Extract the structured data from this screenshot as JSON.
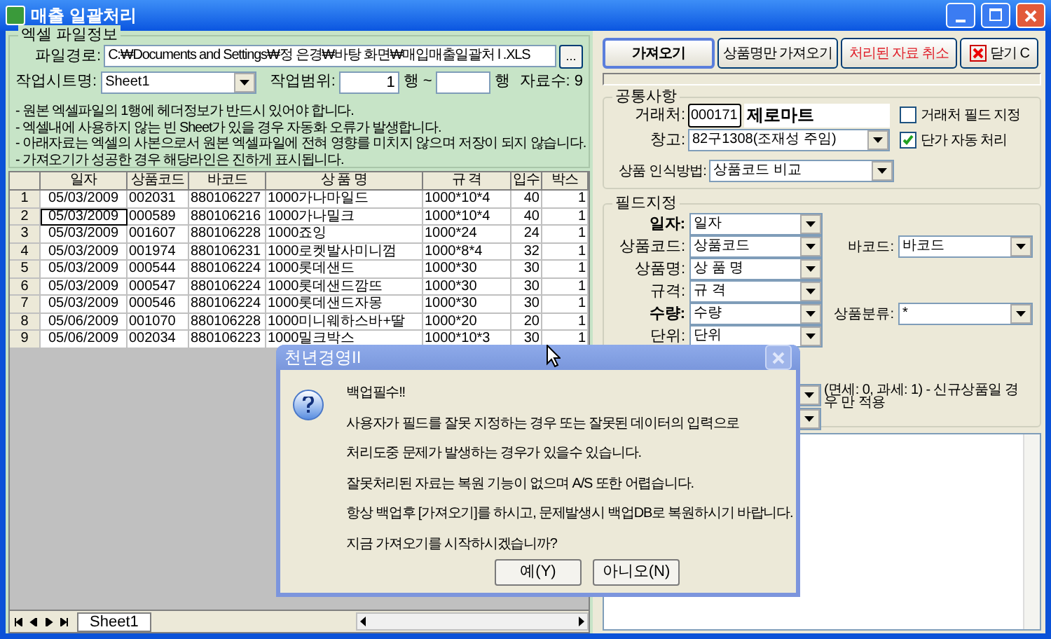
{
  "window": {
    "title": "매출 일괄처리"
  },
  "file_info": {
    "group_label": "엑셀 파일정보",
    "path_label": "파일경로:",
    "path_value": "C:₩Documents and Settings₩정 은경₩바탕 화면₩매입매출일괄처 l .XLS",
    "browse_label": "...",
    "sheet_label": "작업시트명:",
    "sheet_value": "Sheet1",
    "range_label": "작업범위:",
    "range_start": "1",
    "range_sep": "행 ~",
    "range_unit": "행",
    "count": "자료수:  9",
    "notes": [
      "- 원본 엑셀파일의 1행에 헤더정보가 반드시 있어야 합니다.",
      "- 엑셀내에 사용하지 않는 빈 Sheet가 있을 경우 자동화 오류가 발생합니다.",
      "- 아래자료는 엑셀의 사본으로서 원본 엑셀파일에 전혀 영향를 미치지 않으며 저장이 되지 않습니다.",
      "- 가져오기가 성공한 경우 해당라인은 진하게 표시됩니다."
    ]
  },
  "grid": {
    "columns": [
      {
        "kind": "num"
      },
      {
        "label": "일자",
        "kind": "center"
      },
      {
        "label": "상품코드",
        "kind": "text"
      },
      {
        "label": "바코드",
        "kind": "text"
      },
      {
        "label": "상 품 명",
        "kind": "text"
      },
      {
        "label": "규 격",
        "kind": "text"
      },
      {
        "label": "입수",
        "kind": "number"
      },
      {
        "label": "박스",
        "kind": "number"
      }
    ],
    "rows": [
      {
        "selected": false,
        "cells": [
          "1",
          "05/03/2009",
          "002031",
          "880106227",
          "1000가나마일드",
          "1000*10*4",
          "40",
          "1"
        ]
      },
      {
        "selected": true,
        "cells": [
          "2",
          "05/03/2009",
          "000589",
          "880106216",
          "1000가나밀크",
          "1000*10*4",
          "40",
          "1"
        ]
      },
      {
        "selected": false,
        "cells": [
          "3",
          "05/03/2009",
          "001607",
          "880106228",
          "1000죠잉",
          "1000*24",
          "24",
          "1"
        ]
      },
      {
        "selected": false,
        "cells": [
          "4",
          "05/03/2009",
          "001974",
          "880106231",
          "1000로켓발사미니껌",
          "1000*8*4",
          "32",
          "1"
        ]
      },
      {
        "selected": false,
        "cells": [
          "5",
          "05/03/2009",
          "000544",
          "880106224",
          "1000롯데샌드",
          "1000*30",
          "30",
          "1"
        ]
      },
      {
        "selected": false,
        "cells": [
          "6",
          "05/03/2009",
          "000547",
          "880106224",
          "1000롯데샌드깜뜨",
          "1000*30",
          "30",
          "1"
        ]
      },
      {
        "selected": false,
        "cells": [
          "7",
          "05/03/2009",
          "000546",
          "880106224",
          "1000롯데샌드자몽",
          "1000*30",
          "30",
          "1"
        ]
      },
      {
        "selected": false,
        "cells": [
          "8",
          "05/06/2009",
          "001070",
          "880106228",
          "1000미니웨하스바+딸",
          "1000*20",
          "20",
          "1"
        ]
      },
      {
        "selected": false,
        "cells": [
          "9",
          "05/06/2009",
          "002034",
          "880106223",
          "1000밀크박스",
          "1000*10*3",
          "30",
          "1"
        ]
      }
    ],
    "sheet_tabs": [
      {
        "label": "Sheet1",
        "selected": true
      }
    ]
  },
  "buttons": [
    {
      "label": "가져오기",
      "kind": "primary"
    },
    {
      "label": "상품명만 가져오기",
      "kind": "normal"
    },
    {
      "label": "처리된 자료 취소",
      "kind": "danger"
    },
    {
      "label": "닫기 C",
      "kind": "close"
    }
  ],
  "progress": {
    "level": 0
  },
  "common": {
    "group_label": "공통사항",
    "vendor_label": "거래처:",
    "vendor_code": "000171",
    "vendor_name": "제로마트",
    "warehouse_label": "창고:",
    "warehouse_value": "82구1308(조재성 주임)",
    "options": [
      {
        "label": "거래처 필드 지정",
        "checked": false
      },
      {
        "label": "단가 자동 처리",
        "checked": true
      }
    ],
    "match_label": "상품 인식방법:",
    "match_value": "상품코드 비교"
  },
  "fields": {
    "group_label": "필드지정",
    "rows": [
      {
        "label": "일자:",
        "value": "일자",
        "bold": true
      },
      {
        "label": "상품코드:",
        "value": "상품코드",
        "bold": false,
        "side": {
          "label": "바코드:",
          "value": "바코드"
        }
      },
      {
        "label": "상품명:",
        "value": "상 품 명",
        "bold": false
      },
      {
        "label": "규격:",
        "value": "규 격",
        "bold": false
      },
      {
        "label": "수량:",
        "value": "수량",
        "bold": true,
        "side": {
          "label": "상품분류:",
          "value": "*"
        }
      },
      {
        "label": "단위:",
        "value": "단위",
        "bold": false
      }
    ],
    "extra_rows": [
      {
        "note": "(면세: 0, 과세: 1) - 신규상품일 경우 만 적용"
      },
      {}
    ]
  },
  "dialog": {
    "title": "천년경영II",
    "lines": [
      "백업필수!!",
      "사용자가 필드를 잘못 지정하는 경우 또는 잘못된 데이터의 입력으로",
      "처리도중 문제가 발생하는 경우가 있을수 있습니다.",
      "잘못처리된 자료는 복원 기능이 없으며 A/S 또한 어렵습니다.",
      "항상 백업후 [가져오기]를 하시고, 문제발생시 백업DB로 복원하시기 바랍니다.",
      "지금 가져오기를 시작하시겠습니까?"
    ],
    "buttons": [
      {
        "label": "예(Y)"
      },
      {
        "label": "아니오(N)"
      }
    ]
  }
}
